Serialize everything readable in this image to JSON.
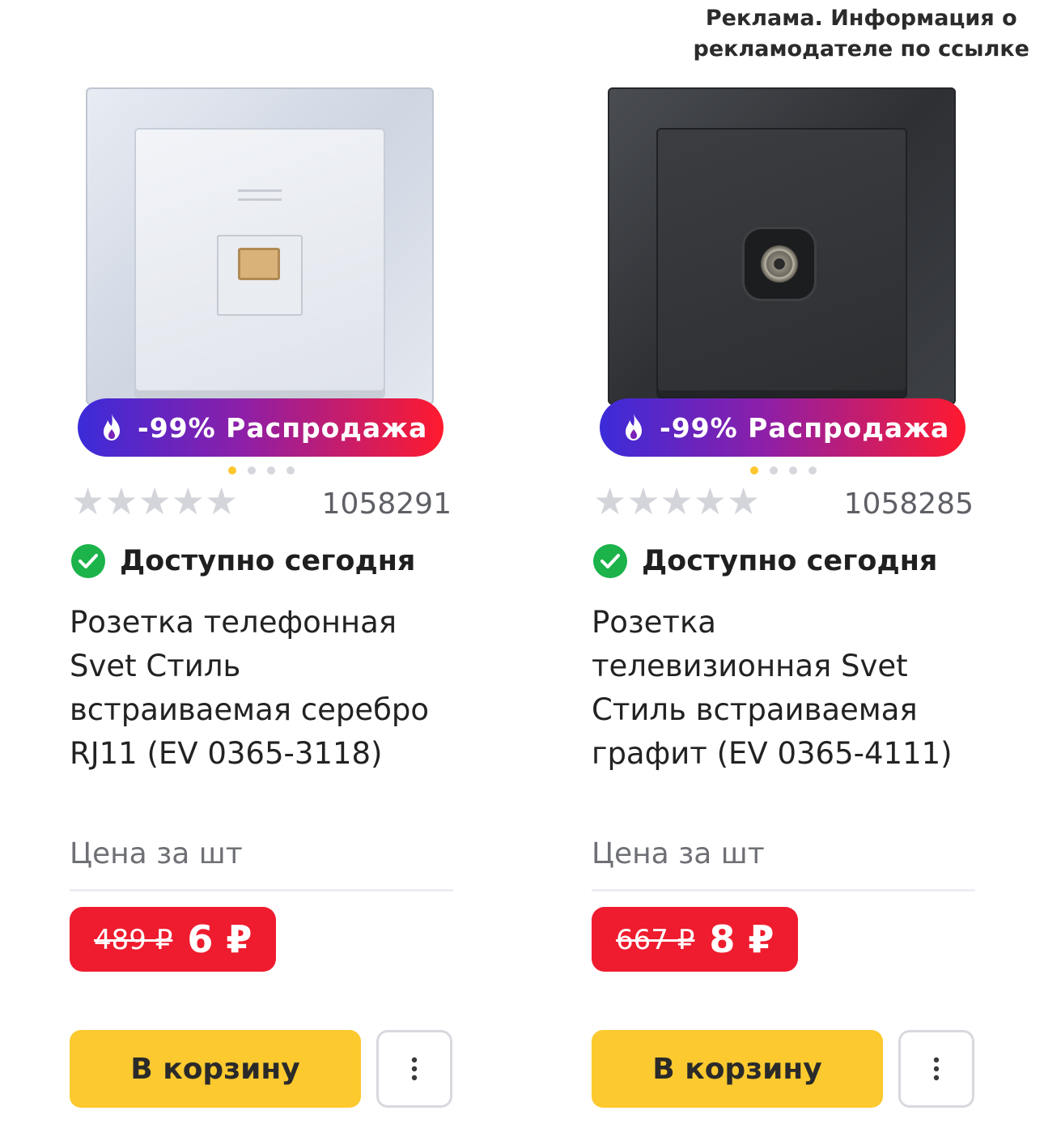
{
  "ad_notice": {
    "line1": "Реклама. Информация о",
    "line2": "рекламодателе по ссылке"
  },
  "colors": {
    "accent_yellow": "#fcc92f",
    "sale_red": "#ee1c2e",
    "available_green": "#1bb34a"
  },
  "products": [
    {
      "sale_badge": "-99% Распродажа",
      "image_variant": "silver",
      "rating_stars": 0,
      "sku": "1058291",
      "availability": "Доступно сегодня",
      "title_lines": [
        "Розетка телефонная",
        "Svet Стиль",
        "встраиваемая серебро",
        "RJ11 (EV 0365-3118)"
      ],
      "price_label": "Цена за  шт",
      "old_price": "489 ₽",
      "new_price": "6 ₽",
      "cart_button": "В корзину",
      "more_icon": "more-vertical-icon"
    },
    {
      "sale_badge": "-99% Распродажа",
      "image_variant": "graphite",
      "rating_stars": 0,
      "sku": "1058285",
      "availability": "Доступно сегодня",
      "title_lines": [
        "Розетка",
        "телевизионная Svet",
        "Стиль встраиваемая",
        "графит (EV 0365-4111)"
      ],
      "price_label": "Цена за  шт",
      "old_price": "667 ₽",
      "new_price": "8 ₽",
      "cart_button": "В корзину",
      "more_icon": "more-vertical-icon"
    }
  ]
}
